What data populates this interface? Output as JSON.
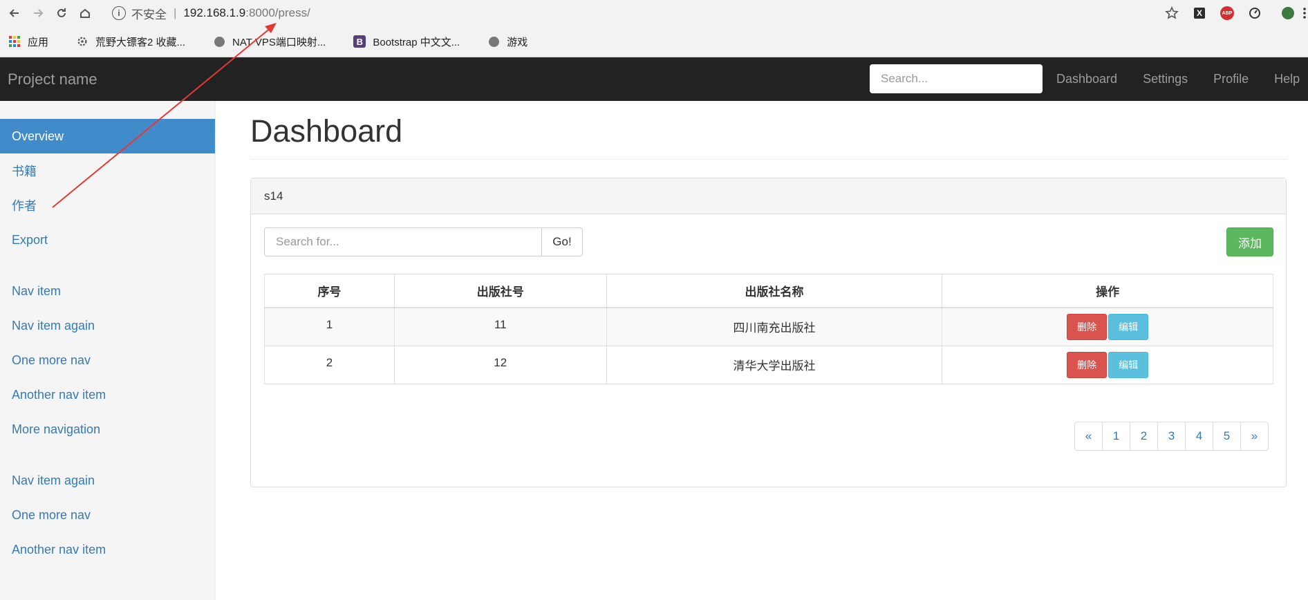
{
  "browser": {
    "security_label": "不安全",
    "url_host": "192.168.1.9",
    "url_rest": ":8000/press/"
  },
  "bookmarks": [
    {
      "label": "应用",
      "icon": "apps-grid-icon"
    },
    {
      "label": "荒野大镖客2 收藏...",
      "icon": "gear-icon"
    },
    {
      "label": "NAT VPS端口映射...",
      "icon": "globe-icon"
    },
    {
      "label": "Bootstrap 中文文...",
      "icon": "bootstrap-icon"
    },
    {
      "label": "游戏",
      "icon": "globe-icon"
    }
  ],
  "navbar": {
    "brand": "Project name",
    "search_placeholder": "Search...",
    "links": [
      "Dashboard",
      "Settings",
      "Profile",
      "Help"
    ]
  },
  "sidebar": {
    "groups": [
      [
        {
          "label": "Overview",
          "active": true
        },
        {
          "label": "书籍"
        },
        {
          "label": "作者"
        },
        {
          "label": "Export"
        }
      ],
      [
        {
          "label": "Nav item"
        },
        {
          "label": "Nav item again"
        },
        {
          "label": "One more nav"
        },
        {
          "label": "Another nav item"
        },
        {
          "label": "More navigation"
        }
      ],
      [
        {
          "label": "Nav item again"
        },
        {
          "label": "One more nav"
        },
        {
          "label": "Another nav item"
        }
      ]
    ]
  },
  "main": {
    "title": "Dashboard",
    "panel_title": "s14",
    "search_placeholder": "Search for...",
    "go_label": "Go!",
    "add_label": "添加",
    "table": {
      "headers": [
        "序号",
        "出版社号",
        "出版社名称",
        "操作"
      ],
      "rows": [
        {
          "index": "1",
          "id": "11",
          "name": "四川南充出版社"
        },
        {
          "index": "2",
          "id": "12",
          "name": "清华大学出版社"
        }
      ],
      "delete_label": "删除",
      "edit_label": "编辑"
    },
    "pagination": [
      "«",
      "1",
      "2",
      "3",
      "4",
      "5",
      "»"
    ]
  },
  "colors": {
    "navbar_bg": "#222222",
    "active_nav": "#428bca",
    "link": "#337ab7",
    "success": "#5cb85c",
    "danger": "#d9534f",
    "info": "#5bc0de",
    "annotation": "#e53935"
  }
}
